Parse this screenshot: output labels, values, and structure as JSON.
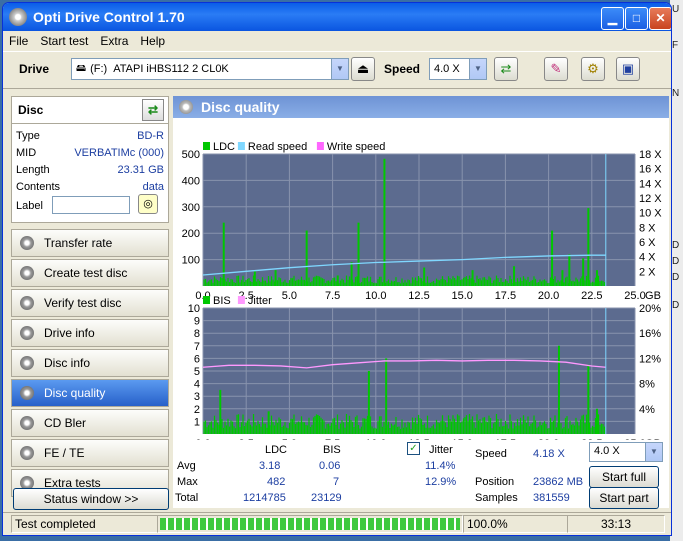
{
  "window": {
    "title": "Opti Drive Control 1.70"
  },
  "menu": [
    "File",
    "Start test",
    "Extra",
    "Help"
  ],
  "toolbar": {
    "drive_label": "Drive",
    "drive_letter": "(F:)",
    "drive_name": "ATAPI iHBS112  2 CL0K",
    "speed_label": "Speed",
    "speed_value": "4.0 X"
  },
  "disc": {
    "header": "Disc",
    "type_label": "Type",
    "type_value": "BD-R",
    "mid_label": "MID",
    "mid_value": "VERBATIMc (000)",
    "length_label": "Length",
    "length_value": "23.31 GB",
    "contents_label": "Contents",
    "contents_value": "data",
    "label_label": "Label",
    "label_value": ""
  },
  "nav": [
    "Transfer rate",
    "Create test disc",
    "Verify test disc",
    "Drive info",
    "Disc info",
    "Disc quality",
    "CD Bler",
    "FE / TE",
    "Extra tests"
  ],
  "nav_active_index": 5,
  "status_window_button": "Status window >>",
  "panel": {
    "title": "Disc quality"
  },
  "chart_data": [
    {
      "type": "bar",
      "legend": [
        "LDC",
        "Read speed",
        "Write speed"
      ],
      "colors": {
        "LDC": "#00c800",
        "Read speed": "#7fd7ff",
        "Write speed": "#ff66ff"
      },
      "xlabel_unit": "GB",
      "x_ticks": [
        "0.0",
        "2.5",
        "5.0",
        "7.5",
        "10.0",
        "12.5",
        "15.0",
        "17.5",
        "20.0",
        "22.5",
        "25.0"
      ],
      "y_ticks_left": [
        "100",
        "200",
        "300",
        "400",
        "500"
      ],
      "y_ticks_right": [
        "2 X",
        "4 X",
        "6 X",
        "8 X",
        "10 X",
        "12 X",
        "14 X",
        "16 X",
        "18 X"
      ],
      "ylim": [
        0,
        500
      ],
      "xlim": [
        0,
        25
      ],
      "y2lim": [
        0,
        18
      ],
      "end_marker_x": 23.31,
      "peaks": [
        [
          1.2,
          240
        ],
        [
          3.0,
          55
        ],
        [
          4.2,
          60
        ],
        [
          6.0,
          210
        ],
        [
          7.8,
          40
        ],
        [
          8.6,
          90
        ],
        [
          9.0,
          240
        ],
        [
          10.5,
          482
        ],
        [
          12.8,
          70
        ],
        [
          15.6,
          60
        ],
        [
          18.0,
          75
        ],
        [
          20.2,
          210
        ],
        [
          20.8,
          60
        ],
        [
          21.2,
          120
        ],
        [
          22.0,
          105
        ],
        [
          22.3,
          295
        ],
        [
          22.8,
          60
        ]
      ],
      "read_speed": [
        [
          0.0,
          1.5
        ],
        [
          2.5,
          2.0
        ],
        [
          5.0,
          2.5
        ],
        [
          7.5,
          2.9
        ],
        [
          10.0,
          3.2
        ],
        [
          12.5,
          3.4
        ],
        [
          15.0,
          3.6
        ],
        [
          17.5,
          3.9
        ],
        [
          20.0,
          4.1
        ],
        [
          22.5,
          4.2
        ],
        [
          23.3,
          4.2
        ]
      ]
    },
    {
      "type": "bar",
      "legend": [
        "BIS",
        "Jitter"
      ],
      "colors": {
        "BIS": "#00c800",
        "Jitter": "#ff99ff"
      },
      "xlabel_unit": "GB",
      "x_ticks": [
        "0.0",
        "2.5",
        "5.0",
        "7.5",
        "10.0",
        "12.5",
        "15.0",
        "17.5",
        "20.0",
        "22.5",
        "25.0"
      ],
      "y_ticks_left": [
        "1",
        "2",
        "3",
        "4",
        "5",
        "6",
        "7",
        "8",
        "9",
        "10"
      ],
      "y_ticks_right": [
        "4%",
        "8%",
        "12%",
        "16%",
        "20%"
      ],
      "ylim": [
        0,
        10
      ],
      "xlim": [
        0,
        25
      ],
      "y2lim": [
        0,
        20
      ],
      "end_marker_x": 23.31,
      "peaks": [
        [
          1.0,
          3.5
        ],
        [
          3.8,
          1.8
        ],
        [
          6.6,
          1.5
        ],
        [
          9.6,
          5.0
        ],
        [
          10.6,
          6.0
        ],
        [
          20.6,
          7.0
        ],
        [
          22.3,
          5.5
        ],
        [
          22.8,
          2.0
        ]
      ],
      "jitter": [
        [
          0.0,
          10.6
        ],
        [
          1.5,
          10.9
        ],
        [
          3.0,
          10.9
        ],
        [
          4.5,
          10.8
        ],
        [
          6.0,
          10.5
        ],
        [
          7.5,
          11.0
        ],
        [
          9.0,
          11.3
        ],
        [
          10.5,
          11.6
        ],
        [
          12.0,
          11.6
        ],
        [
          13.5,
          11.7
        ],
        [
          15.0,
          11.6
        ],
        [
          16.5,
          11.7
        ],
        [
          18.0,
          11.7
        ],
        [
          19.5,
          11.6
        ],
        [
          21.0,
          11.4
        ],
        [
          22.5,
          10.8
        ],
        [
          23.3,
          10.6
        ]
      ]
    }
  ],
  "stats": {
    "col_ldc": "LDC",
    "col_bis": "BIS",
    "col_jitter": "Jitter",
    "avg_label": "Avg",
    "avg_ldc": "3.18",
    "avg_bis": "0.06",
    "avg_jitter": "11.4%",
    "max_label": "Max",
    "max_ldc": "482",
    "max_bis": "7",
    "max_jitter": "12.9%",
    "total_label": "Total",
    "total_ldc": "1214785",
    "total_bis": "23129",
    "speed_label": "Speed",
    "speed_value": "4.18 X",
    "speed_select": "4.0 X",
    "position_label": "Position",
    "position_value": "23862 MB",
    "samples_label": "Samples",
    "samples_value": "381559",
    "start_full": "Start full",
    "start_part": "Start part"
  },
  "statusbar": {
    "text": "Test completed",
    "progress": "100.0%",
    "progress_fraction": 1.0,
    "time": "33:13"
  },
  "desktop_fragments": [
    "U",
    "F",
    "N",
    "D",
    "D",
    "D",
    "D",
    "D"
  ]
}
